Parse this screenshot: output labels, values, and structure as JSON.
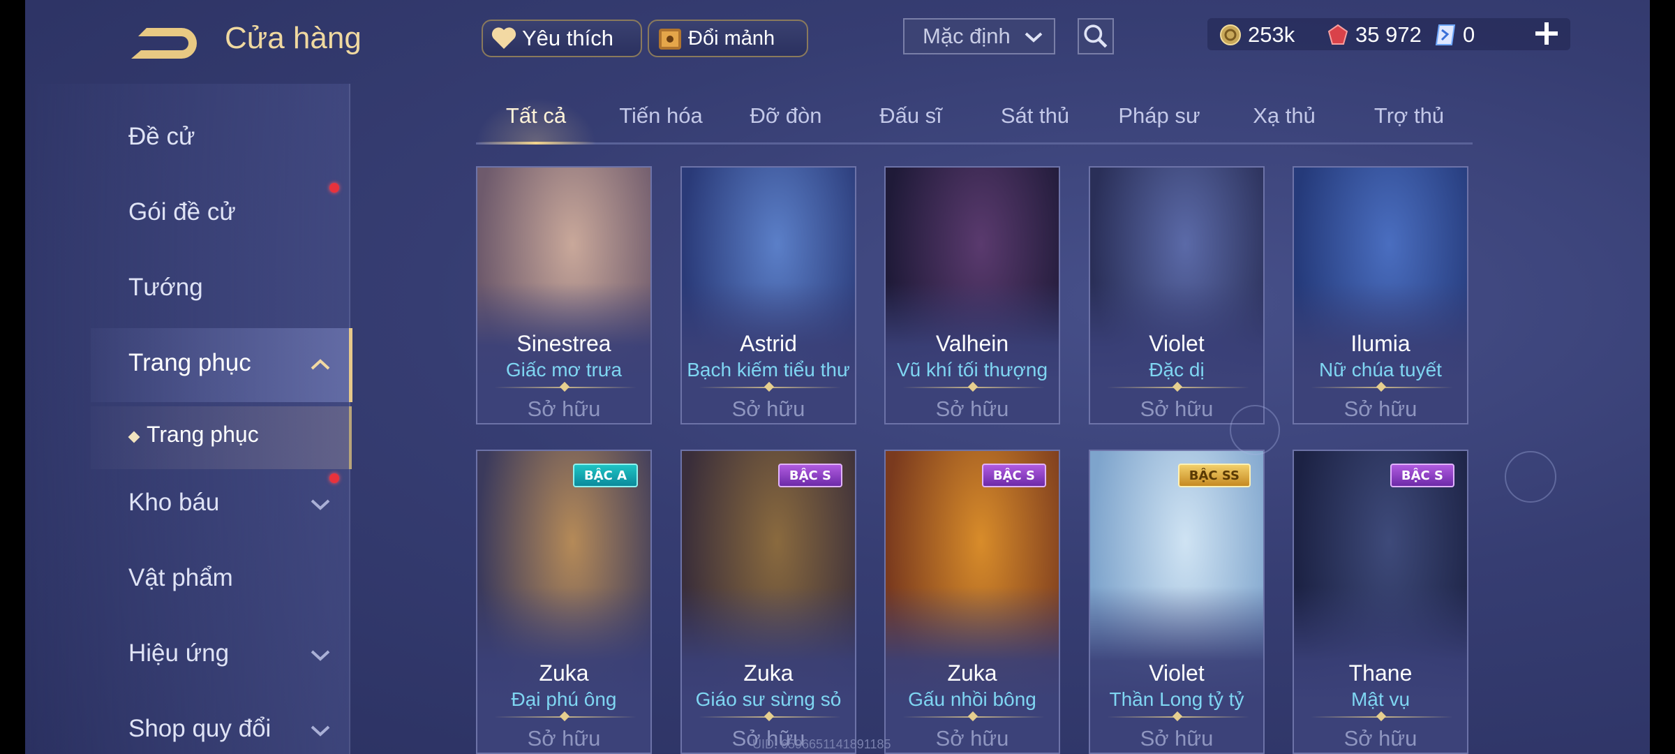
{
  "header": {
    "title": "Cửa hàng",
    "favorite_label": "Yêu thích",
    "swap_label": "Đổi mảnh",
    "sort_value": "Mặc định",
    "currencies": [
      {
        "icon": "gold-coin-icon",
        "value": "253k"
      },
      {
        "icon": "ruby-gem-icon",
        "value": "35 972"
      },
      {
        "icon": "voucher-icon",
        "value": "0"
      }
    ]
  },
  "sidebar": {
    "items": [
      {
        "label": "Đề cử"
      },
      {
        "label": "Gói đề cử",
        "dot": true
      },
      {
        "label": "Tướng"
      },
      {
        "label": "Trang phục",
        "expanded": true
      },
      {
        "label": "Trang phục",
        "sub": true
      },
      {
        "label": "Kho báu",
        "dot": true
      },
      {
        "label": "Vật phẩm"
      },
      {
        "label": "Hiệu ứng"
      },
      {
        "label": "Shop quy đổi"
      }
    ]
  },
  "tabs": [
    "Tất cả",
    "Tiến hóa",
    "Đỡ đòn",
    "Đấu sĩ",
    "Sát thủ",
    "Pháp sư",
    "Xạ thủ",
    "Trợ thủ"
  ],
  "cards": [
    {
      "hero": "Sinestrea",
      "skin": "Giấc mơ trưa",
      "status": "Sở hữu",
      "badge": "",
      "palette": [
        "#c9a89a",
        "#6e5a6c"
      ]
    },
    {
      "hero": "Astrid",
      "skin": "Bạch kiếm tiểu thư",
      "status": "Sở hữu",
      "badge": "",
      "palette": [
        "#5b7fc8",
        "#2a3a78"
      ]
    },
    {
      "hero": "Valhein",
      "skin": "Vũ khí tối thượng",
      "status": "Sở hữu",
      "badge": "",
      "palette": [
        "#5a3a6e",
        "#1f1a38"
      ]
    },
    {
      "hero": "Violet",
      "skin": "Đặc dị",
      "status": "Sở hữu",
      "badge": "",
      "palette": [
        "#5b6aa8",
        "#2a2f58"
      ]
    },
    {
      "hero": "Ilumia",
      "skin": "Nữ chúa tuyết",
      "status": "Sở hữu",
      "badge": "",
      "palette": [
        "#4a6ec0",
        "#253a7a"
      ]
    },
    {
      "hero": "Zuka",
      "skin": "Đại phú ông",
      "status": "Sở hữu",
      "badge": "BẬC A",
      "palette": [
        "#b58a58",
        "#3b3a5c"
      ]
    },
    {
      "hero": "Zuka",
      "skin": "Giáo sư sừng sỏ",
      "status": "Sở hữu",
      "badge": "BẬC S",
      "palette": [
        "#8a6a3e",
        "#3a2e3a"
      ]
    },
    {
      "hero": "Zuka",
      "skin": "Gấu nhồi bông",
      "status": "Sở hữu",
      "badge": "BẬC S",
      "palette": [
        "#d88c2a",
        "#7a3a1e"
      ]
    },
    {
      "hero": "Violet",
      "skin": "Thần Long tỷ tỷ",
      "status": "Sở hữu",
      "badge": "BẬC SS",
      "palette": [
        "#cfe3f3",
        "#7ea4cc"
      ]
    },
    {
      "hero": "Thane",
      "skin": "Mật vụ",
      "status": "Sở hữu",
      "badge": "BẬC S",
      "palette": [
        "#3e4a7a",
        "#1c2244"
      ]
    }
  ],
  "uid": "UID: 6596651141891185"
}
